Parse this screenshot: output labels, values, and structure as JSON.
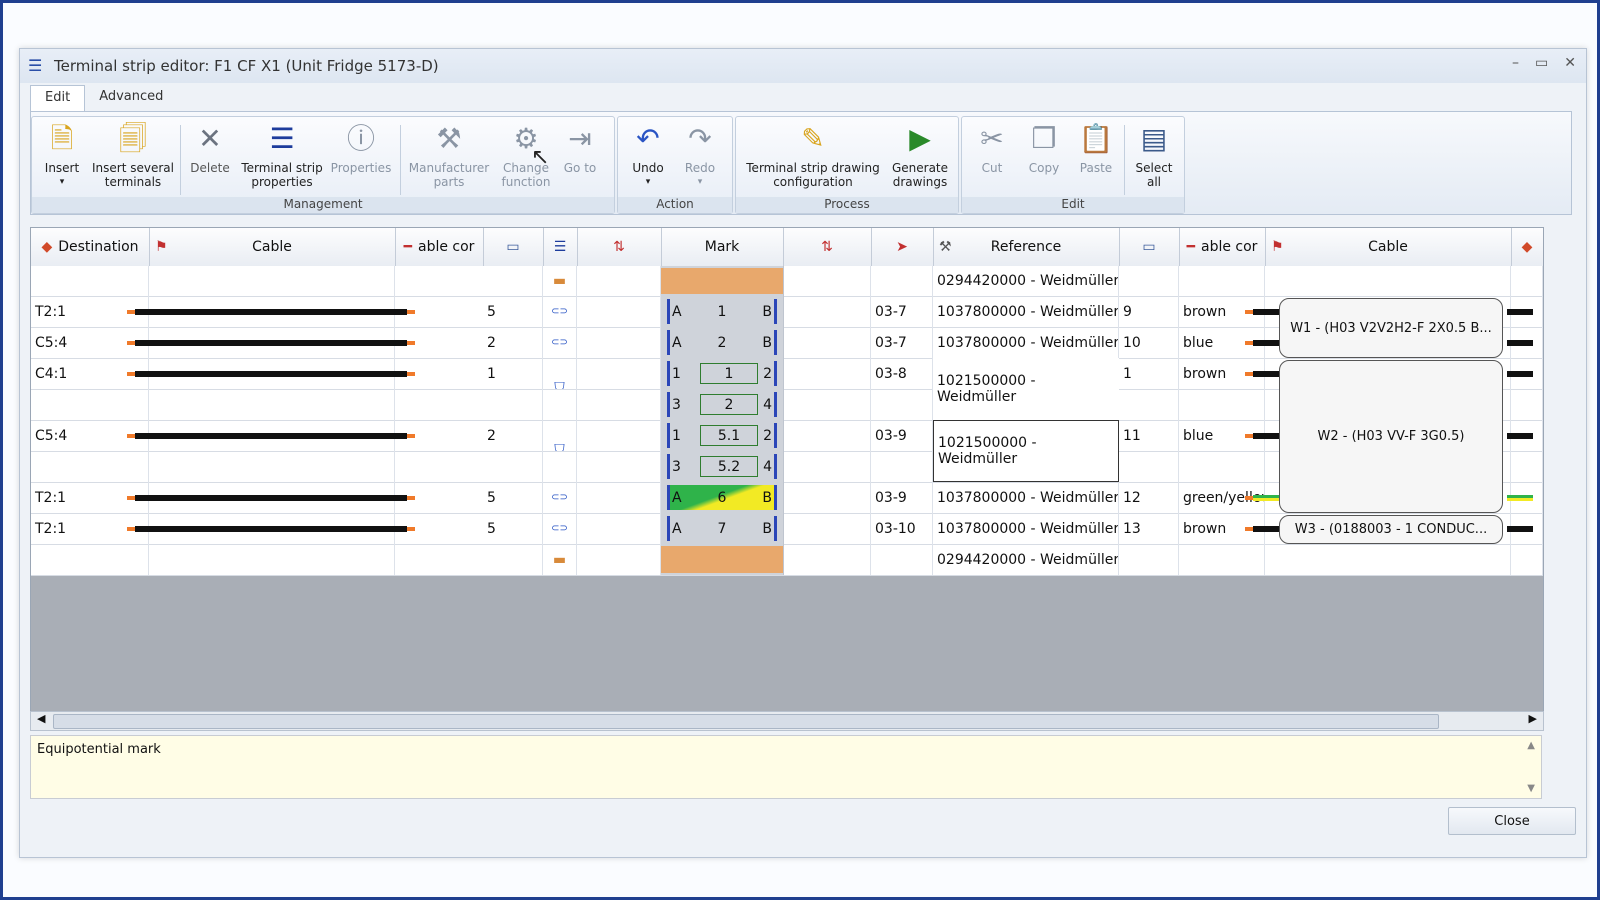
{
  "window": {
    "title": "Terminal strip editor: F1 CF X1 (Unit Fridge 5173-D)"
  },
  "tabs": [
    "Edit",
    "Advanced"
  ],
  "ribbon": {
    "groups": {
      "management": "Management",
      "action": "Action",
      "process": "Process",
      "edit": "Edit"
    },
    "buttons": {
      "insert": "Insert",
      "insert_several": "Insert several terminals",
      "delete": "Delete",
      "strip_props": "Terminal strip properties",
      "properties": "Properties",
      "manufacturer": "Manufacturer parts",
      "change_function": "Change function",
      "goto": "Go to",
      "undo": "Undo",
      "redo": "Redo",
      "drawing_config": "Terminal strip drawing configuration",
      "generate": "Generate drawings",
      "cut": "Cut",
      "copy": "Copy",
      "paste": "Paste",
      "select_all": "Select all"
    }
  },
  "columns": {
    "destination": "Destination",
    "cable": "Cable",
    "cable_core": "able cor",
    "mark": "Mark",
    "reference": "Reference",
    "cable_core_r": "able cor",
    "cable_r": "Cable"
  },
  "rows": [
    {
      "dest": "",
      "core": "",
      "mark_type": "end",
      "page": "",
      "ref": "0294420000 - Weidmüller",
      "rcore": "",
      "rcolor": ""
    },
    {
      "dest": "T2:1",
      "core": "5",
      "mark_type": "term",
      "mark_l": "A",
      "mark": "1",
      "mark_r": "B",
      "page": "03-7",
      "ref": "1037800000 - Weidmüller",
      "rcore": "9",
      "rcolor": "brown"
    },
    {
      "dest": "C5:4",
      "core": "2",
      "mark_type": "term",
      "mark_l": "A",
      "mark": "2",
      "mark_r": "B",
      "page": "03-7",
      "ref": "1037800000 - Weidmüller",
      "rcore": "10",
      "rcolor": "blue"
    },
    {
      "dest": "C4:1",
      "core": "1",
      "mark_type": "bridge",
      "mark_l": "1",
      "mark": "1",
      "mark_r": "2",
      "page": "03-8",
      "ref": "1021500000 - Weidmüller",
      "rcore": "1",
      "rcolor": "brown"
    },
    {
      "dest": "",
      "core": "",
      "mark_type": "bridge",
      "mark_l": "3",
      "mark": "2",
      "mark_r": "4",
      "page": "",
      "ref": "",
      "rcore": "",
      "rcolor": ""
    },
    {
      "dest": "C5:4",
      "core": "2",
      "mark_type": "bridge",
      "mark_l": "1",
      "mark": "5.1",
      "mark_r": "2",
      "page": "03-9",
      "ref": "1021500000 - Weidmüller",
      "rcore": "11",
      "rcolor": "blue"
    },
    {
      "dest": "",
      "core": "",
      "mark_type": "bridge",
      "mark_l": "3",
      "mark": "5.2",
      "mark_r": "4",
      "page": "",
      "ref": "",
      "rcore": "",
      "rcolor": ""
    },
    {
      "dest": "T2:1",
      "core": "5",
      "mark_type": "pe",
      "mark_l": "A",
      "mark": "6",
      "mark_r": "B",
      "page": "03-9",
      "ref": "1037800000 - Weidmüller",
      "rcore": "12",
      "rcolor": "green/yellow"
    },
    {
      "dest": "T2:1",
      "core": "5",
      "mark_type": "term",
      "mark_l": "A",
      "mark": "7",
      "mark_r": "B",
      "page": "03-10",
      "ref": "1037800000 - Weidmüller",
      "rcore": "13",
      "rcolor": "brown"
    },
    {
      "dest": "",
      "core": "",
      "mark_type": "end",
      "page": "",
      "ref": "0294420000 - Weidmüller",
      "rcore": "",
      "rcolor": ""
    }
  ],
  "cables": [
    "W1 - (H03 V2V2H2-F 2X0.5 B...",
    "W2 - (H03 VV-F 3G0.5)",
    "W3 - (0188003 - 1 CONDUC..."
  ],
  "description": "Equipotential mark",
  "close_label": "Close"
}
